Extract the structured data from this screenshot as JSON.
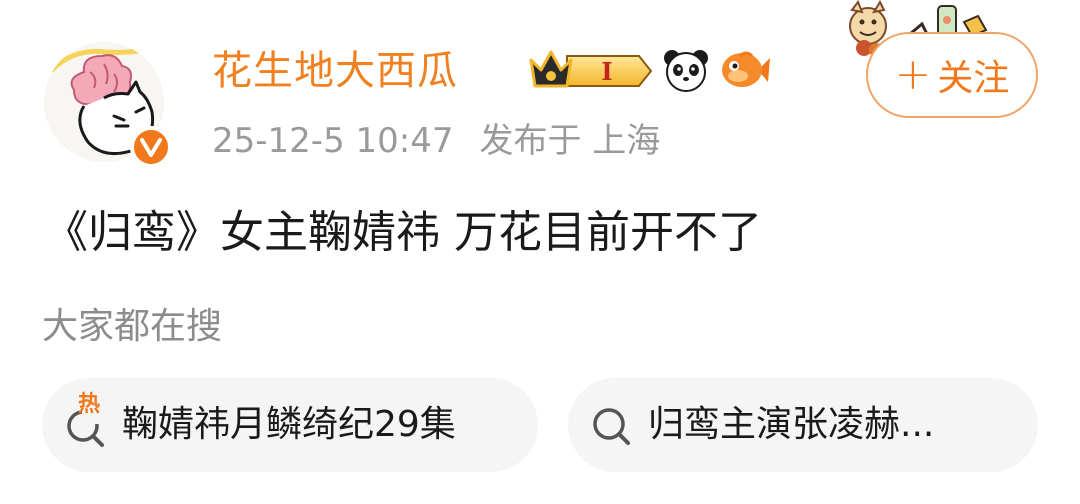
{
  "post": {
    "author": {
      "name": "花生地大西瓜",
      "verified_mark": "V",
      "level_badge": "I",
      "badges": [
        "crown-level-icon",
        "panda-icon",
        "fish-icon"
      ]
    },
    "time": "25-12-5 10:47",
    "location": "发布于 上海",
    "follow": {
      "plus": "+",
      "label": "关注"
    },
    "text": "《归鸾》女主鞠婧祎 万花目前开不了"
  },
  "searching": {
    "title": "大家都在搜",
    "hot_mark": "热",
    "items": [
      {
        "label": "鞠婧祎月鳞绮纪29集",
        "icon": "hot-search-icon"
      },
      {
        "label": "归鸾主演张凌赫...",
        "icon": "search-icon"
      }
    ]
  },
  "colors": {
    "accent": "#f1781b",
    "username": "#f18020",
    "meta": "#9a9a9a",
    "chip_bg": "#f5f5f5"
  }
}
